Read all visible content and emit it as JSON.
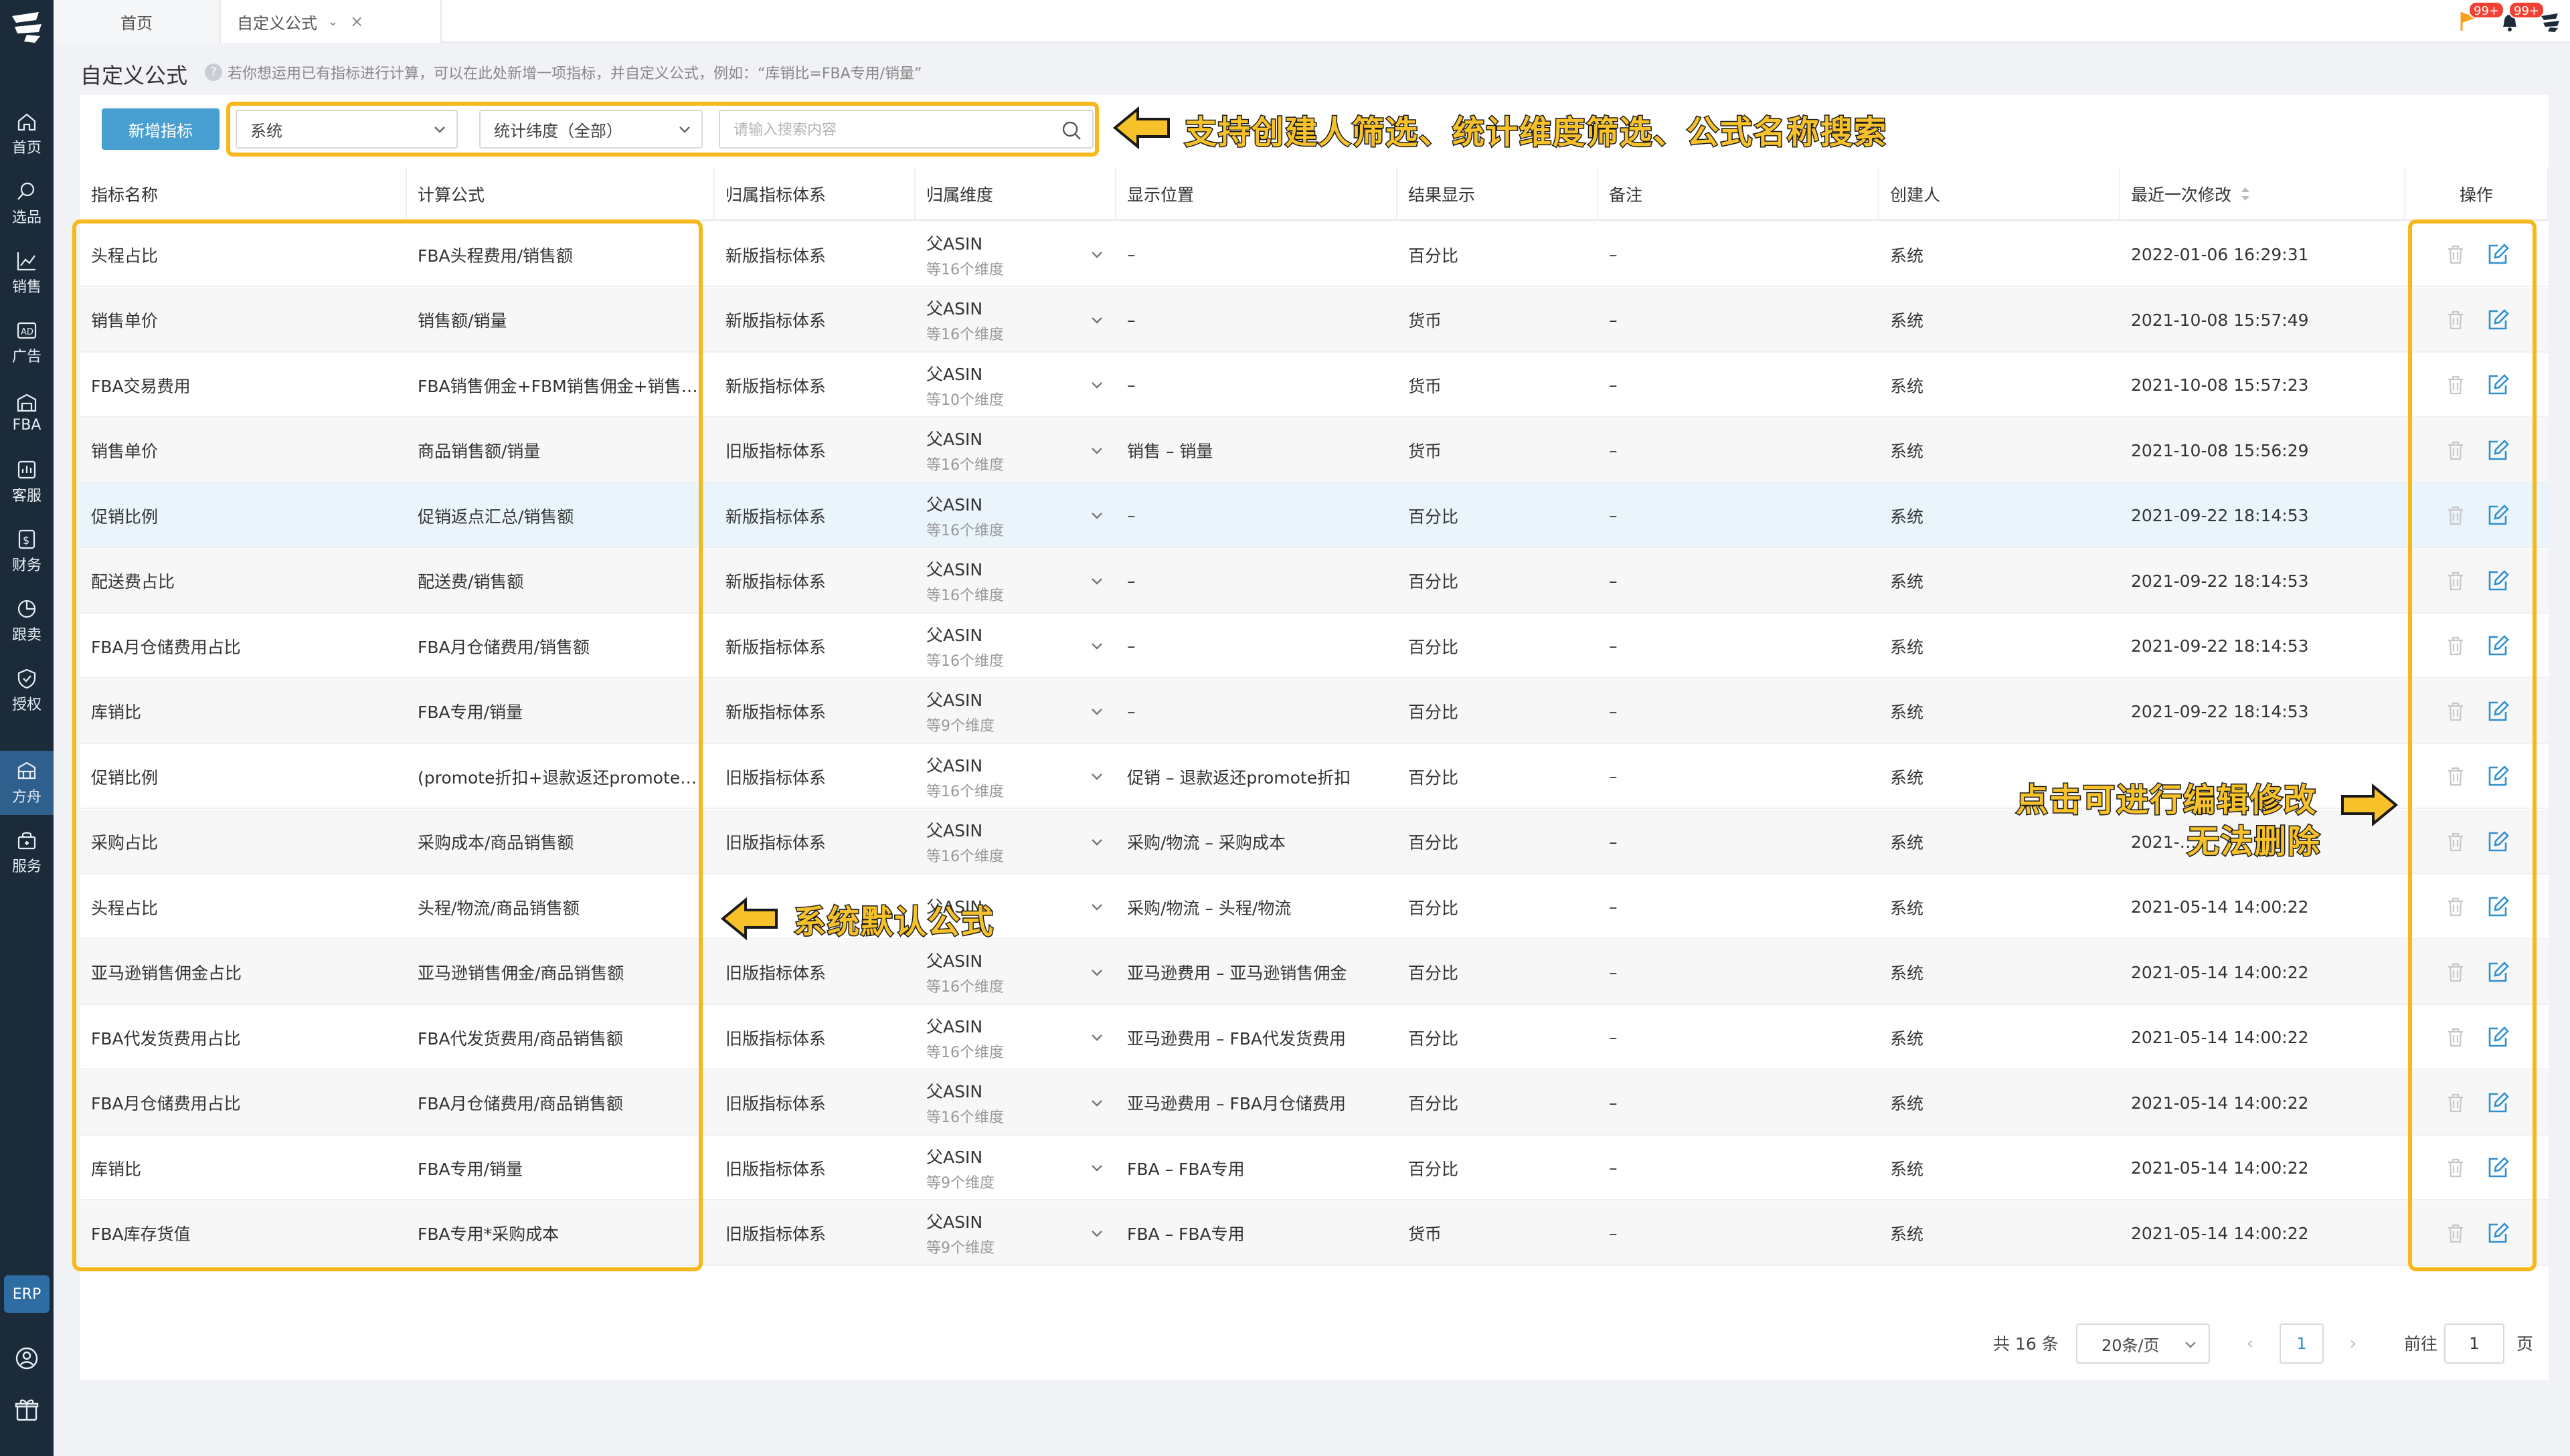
{
  "sidebar": {
    "items": [
      {
        "label": "首页",
        "icon": "home-icon"
      },
      {
        "label": "选品",
        "icon": "search-icon"
      },
      {
        "label": "销售",
        "icon": "chart-icon"
      },
      {
        "label": "广告",
        "icon": "ad-icon"
      },
      {
        "label": "FBA",
        "icon": "warehouse-icon"
      },
      {
        "label": "客服",
        "icon": "service-icon"
      },
      {
        "label": "财务",
        "icon": "finance-icon"
      },
      {
        "label": "跟卖",
        "icon": "pie-icon"
      },
      {
        "label": "授权",
        "icon": "shield-icon"
      },
      {
        "label": "方舟",
        "icon": "ark-icon"
      },
      {
        "label": "服务",
        "icon": "store-icon"
      }
    ],
    "active_index": 9,
    "erp_label": "ERP"
  },
  "tabs": [
    {
      "label": "首页"
    },
    {
      "label": "自定义公式"
    }
  ],
  "topbar": {
    "badge_flag": "99+",
    "badge_bell": "99+"
  },
  "page": {
    "title": "自定义公式",
    "hint": "若你想运用已有指标进行计算，可以在此处新增一项指标，并自定义公式，例如：“库销比=FBA专用/销量”"
  },
  "toolbar": {
    "add_label": "新增指标",
    "creator_select": "系统",
    "dimension_select": "统计纬度（全部）",
    "search_placeholder": "请输入搜索内容"
  },
  "table": {
    "headers": [
      "指标名称",
      "计算公式",
      "归属指标体系",
      "归属维度",
      "显示位置",
      "结果显示",
      "备注",
      "创建人",
      "最近一次修改",
      "操作"
    ],
    "rows": [
      {
        "name": "头程占比",
        "formula": "FBA头程费用/销售额",
        "system": "新版指标体系",
        "dim": "父ASIN",
        "dim_sub": "等16个维度",
        "position": "–",
        "result": "百分比",
        "note": "–",
        "creator": "系统",
        "modified": "2022-01-06 16:29:31"
      },
      {
        "name": "销售单价",
        "formula": "销售额/销量",
        "system": "新版指标体系",
        "dim": "父ASIN",
        "dim_sub": "等16个维度",
        "position": "–",
        "result": "货币",
        "note": "–",
        "creator": "系统",
        "modified": "2021-10-08 15:57:49"
      },
      {
        "name": "FBA交易费用",
        "formula": "FBA销售佣金+FBM销售佣金+销售…",
        "system": "新版指标体系",
        "dim": "父ASIN",
        "dim_sub": "等10个维度",
        "position": "–",
        "result": "货币",
        "note": "–",
        "creator": "系统",
        "modified": "2021-10-08 15:57:23"
      },
      {
        "name": "销售单价",
        "formula": "商品销售额/销量",
        "system": "旧版指标体系",
        "dim": "父ASIN",
        "dim_sub": "等16个维度",
        "position": "销售 – 销量",
        "result": "货币",
        "note": "–",
        "creator": "系统",
        "modified": "2021-10-08 15:56:29"
      },
      {
        "name": "促销比例",
        "formula": "促销返点汇总/销售额",
        "system": "新版指标体系",
        "dim": "父ASIN",
        "dim_sub": "等16个维度",
        "position": "–",
        "result": "百分比",
        "note": "–",
        "creator": "系统",
        "modified": "2021-09-22 18:14:53"
      },
      {
        "name": "配送费占比",
        "formula": "配送费/销售额",
        "system": "新版指标体系",
        "dim": "父ASIN",
        "dim_sub": "等16个维度",
        "position": "–",
        "result": "百分比",
        "note": "–",
        "creator": "系统",
        "modified": "2021-09-22 18:14:53"
      },
      {
        "name": "FBA月仓储费用占比",
        "formula": "FBA月仓储费用/销售额",
        "system": "新版指标体系",
        "dim": "父ASIN",
        "dim_sub": "等16个维度",
        "position": "–",
        "result": "百分比",
        "note": "–",
        "creator": "系统",
        "modified": "2021-09-22 18:14:53"
      },
      {
        "name": "库销比",
        "formula": "FBA专用/销量",
        "system": "新版指标体系",
        "dim": "父ASIN",
        "dim_sub": "等9个维度",
        "position": "–",
        "result": "百分比",
        "note": "–",
        "creator": "系统",
        "modified": "2021-09-22 18:14:53"
      },
      {
        "name": "促销比例",
        "formula": "(promote折扣+退款返还promote…",
        "system": "旧版指标体系",
        "dim": "父ASIN",
        "dim_sub": "等16个维度",
        "position": "促销 – 退款返还promote折扣",
        "result": "百分比",
        "note": "–",
        "creator": "系统",
        "modified": ""
      },
      {
        "name": "采购占比",
        "formula": "采购成本/商品销售额",
        "system": "旧版指标体系",
        "dim": "父ASIN",
        "dim_sub": "等16个维度",
        "position": "采购/物流 – 采购成本",
        "result": "百分比",
        "note": "–",
        "creator": "系统",
        "modified": "2021-…"
      },
      {
        "name": "头程占比",
        "formula": "头程/物流/商品销售额",
        "system": "",
        "dim": "父ASIN",
        "dim_sub": "",
        "position": "采购/物流 – 头程/物流",
        "result": "百分比",
        "note": "–",
        "creator": "系统",
        "modified": "2021-05-14 14:00:22"
      },
      {
        "name": "亚马逊销售佣金占比",
        "formula": "亚马逊销售佣金/商品销售额",
        "system": "旧版指标体系",
        "dim": "父ASIN",
        "dim_sub": "等16个维度",
        "position": "亚马逊费用 – 亚马逊销售佣金",
        "result": "百分比",
        "note": "–",
        "creator": "系统",
        "modified": "2021-05-14 14:00:22"
      },
      {
        "name": "FBA代发货费用占比",
        "formula": "FBA代发货费用/商品销售额",
        "system": "旧版指标体系",
        "dim": "父ASIN",
        "dim_sub": "等16个维度",
        "position": "亚马逊费用 – FBA代发货费用",
        "result": "百分比",
        "note": "–",
        "creator": "系统",
        "modified": "2021-05-14 14:00:22"
      },
      {
        "name": "FBA月仓储费用占比",
        "formula": "FBA月仓储费用/商品销售额",
        "system": "旧版指标体系",
        "dim": "父ASIN",
        "dim_sub": "等16个维度",
        "position": "亚马逊费用 – FBA月仓储费用",
        "result": "百分比",
        "note": "–",
        "creator": "系统",
        "modified": "2021-05-14 14:00:22"
      },
      {
        "name": "库销比",
        "formula": "FBA专用/销量",
        "system": "旧版指标体系",
        "dim": "父ASIN",
        "dim_sub": "等9个维度",
        "position": "FBA – FBA专用",
        "result": "百分比",
        "note": "–",
        "creator": "系统",
        "modified": "2021-05-14 14:00:22"
      },
      {
        "name": "FBA库存货值",
        "formula": "FBA专用*采购成本",
        "system": "旧版指标体系",
        "dim": "父ASIN",
        "dim_sub": "等9个维度",
        "position": "FBA – FBA专用",
        "result": "货币",
        "note": "–",
        "creator": "系统",
        "modified": "2021-05-14 14:00:22"
      }
    ]
  },
  "annotations": {
    "filter_note": "支持创建人筛选、统计维度筛选、公式名称搜索",
    "default_note": "系统默认公式",
    "edit_note_line1": "点击可进行编辑修改",
    "edit_note_line2": "无法删除"
  },
  "pagination": {
    "total": "共 16 条",
    "page_size": "20条/页",
    "prev": "‹",
    "current": "1",
    "next": "›",
    "goto_label": "前往",
    "goto_value": "1",
    "page_suffix": "页"
  },
  "colors": {
    "sidebar_bg": "#1c2b3a",
    "accent_blue": "#4a9fd1",
    "highlight_yellow": "#f7b81c",
    "badge_red": "#f04134",
    "edit_blue": "#2f8fd0"
  }
}
